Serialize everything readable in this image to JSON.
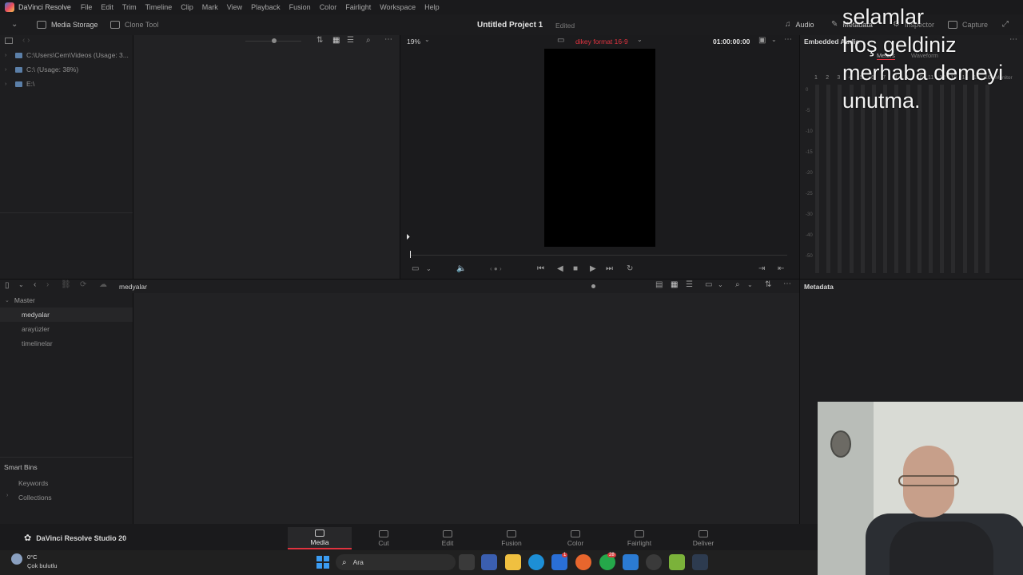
{
  "menubar": {
    "app_name": "DaVinci Resolve",
    "items": [
      "File",
      "Edit",
      "Trim",
      "Timeline",
      "Clip",
      "Mark",
      "View",
      "Playback",
      "Fusion",
      "Color",
      "Fairlight",
      "Workspace",
      "Help"
    ]
  },
  "toolbar": {
    "media_storage": "Media Storage",
    "clone_tool": "Clone Tool",
    "project_title": "Untitled Project 1",
    "project_status": "Edited",
    "audio": "Audio",
    "metadata": "Metadata",
    "inspector": "Inspector",
    "capture": "Capture"
  },
  "storage": {
    "drives": [
      "C:\\Users\\Cem\\Videos (Usage: 3...",
      "C:\\ (Usage: 38%)",
      "E:\\"
    ]
  },
  "viewer": {
    "zoom": "19%",
    "timeline_name": "dikey format 16-9",
    "timecode": "01:00:00:00"
  },
  "audio_panel": {
    "title": "Embedded Audio",
    "tabs": [
      "Meters",
      "Waveform"
    ],
    "channels": [
      "1",
      "2",
      "3",
      "4",
      "5",
      "6",
      "7",
      "8",
      "9",
      "10",
      "11",
      "12",
      "13",
      "14",
      "15",
      "16"
    ],
    "db_marks": [
      "0",
      "-5",
      "-10",
      "-15",
      "-20",
      "-25",
      "-30",
      "-40",
      "-50"
    ],
    "monitor": "Monitor"
  },
  "media_pool": {
    "bin_title": "medyalar",
    "master": "Master",
    "bins": [
      "medyalar",
      "arayüzler",
      "timelinelar"
    ],
    "smart_bins": "Smart Bins",
    "smart_items": [
      "Keywords",
      "Collections"
    ]
  },
  "metadata_panel": {
    "title": "Metadata"
  },
  "footer": {
    "version": "DaVinci Resolve Studio 20"
  },
  "pages": [
    {
      "label": "Media",
      "active": true
    },
    {
      "label": "Cut",
      "active": false
    },
    {
      "label": "Edit",
      "active": false
    },
    {
      "label": "Fusion",
      "active": false
    },
    {
      "label": "Color",
      "active": false
    },
    {
      "label": "Fairlight",
      "active": false
    },
    {
      "label": "Deliver",
      "active": false
    }
  ],
  "taskbar": {
    "weather_temp": "0°C",
    "weather_desc": "Çok bulutlu",
    "search_placeholder": "Ara",
    "badge_whatsapp": "28",
    "badge_store": "1"
  },
  "overlay": {
    "lines": [
      "selamlar",
      "hoş geldiniz",
      "merhaba demeyi",
      "unutma."
    ]
  },
  "colors": {
    "accent_red": "#e0333f",
    "panel_bg": "#1e1e20"
  }
}
